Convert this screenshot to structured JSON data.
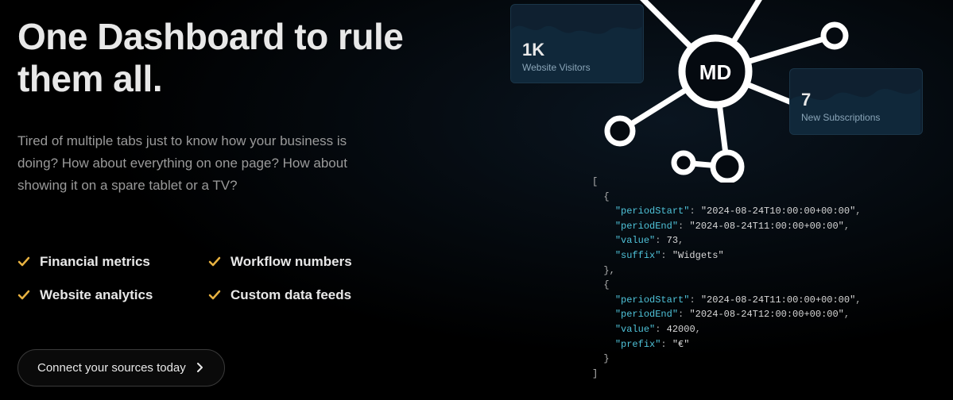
{
  "hero": {
    "title": "One Dashboard to rule them all.",
    "description": "Tired of multiple tabs just to know how your business is doing? How about everything on one page? How about showing it on a spare tablet or a TV?"
  },
  "features": [
    "Financial metrics",
    "Workflow numbers",
    "Website analytics",
    "Custom data feeds"
  ],
  "cta": {
    "label": "Connect your sources today"
  },
  "logo": "MD",
  "stats": [
    {
      "value": "1K",
      "label": "Website Visitors"
    },
    {
      "value": "7",
      "label": "New Subscriptions"
    }
  ],
  "code": {
    "items": [
      {
        "periodStart": "2024-08-24T10:00:00+00:00",
        "periodEnd": "2024-08-24T11:00:00+00:00",
        "value": "73",
        "extraKey": "suffix",
        "extraVal": "Widgets"
      },
      {
        "periodStart": "2024-08-24T11:00:00+00:00",
        "periodEnd": "2024-08-24T12:00:00+00:00",
        "value": "42000",
        "extraKey": "prefix",
        "extraVal": "€"
      }
    ]
  },
  "colors": {
    "accent": "#e8b241"
  }
}
